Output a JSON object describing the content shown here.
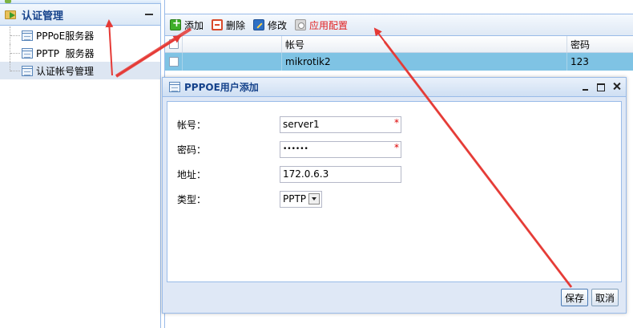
{
  "sidebar": {
    "title": "认证管理",
    "items": [
      {
        "label": "PPPoE服务器"
      },
      {
        "label": "PPTP  服务器"
      },
      {
        "label": "认证帐号管理"
      }
    ]
  },
  "toolbar": {
    "add_label": "添加",
    "delete_label": "删除",
    "edit_label": "修改",
    "apply_label": "应用配置"
  },
  "grid": {
    "columns": [
      "",
      "",
      "帐号",
      "密码"
    ],
    "rows": [
      {
        "account": "mikrotik2",
        "password": "123"
      }
    ]
  },
  "dialog": {
    "title": "PPPOE用户添加",
    "fields": {
      "account_label": "帐号：",
      "account_value": "server1",
      "password_label": "密码：",
      "password_value": "••••••",
      "address_label": "地址：",
      "address_value": "172.0.6.3",
      "type_label": "类型：",
      "type_value": "PPTP"
    },
    "required_mark": "*",
    "save_label": "保存",
    "cancel_label": "取消"
  },
  "colors": {
    "selected_row": "#7fc3e4",
    "panel_border": "#99bbe8",
    "annotation": "#e53935"
  }
}
